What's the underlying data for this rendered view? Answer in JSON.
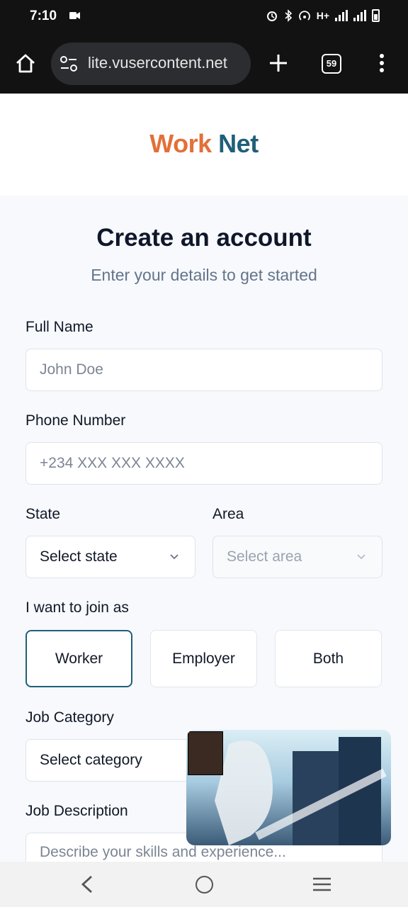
{
  "status_bar": {
    "time": "7:10",
    "network": "H+"
  },
  "browser": {
    "url": "lite.vusercontent.net",
    "tab_count": "59"
  },
  "brand": {
    "part1": "Work",
    "part2": "Net",
    "colors": {
      "work": "#e2703a",
      "net": "#1f5f7a"
    }
  },
  "form": {
    "title": "Create an account",
    "subtitle": "Enter your details to get started",
    "full_name": {
      "label": "Full Name",
      "placeholder": "John Doe"
    },
    "phone": {
      "label": "Phone Number",
      "placeholder": "+234 XXX XXX XXXX"
    },
    "state": {
      "label": "State",
      "value": "Select state"
    },
    "area": {
      "label": "Area",
      "value": "Select area"
    },
    "join_as": {
      "label": "I want to join as",
      "options": [
        "Worker",
        "Employer",
        "Both"
      ],
      "selected": "Worker"
    },
    "job_category": {
      "label": "Job Category",
      "value": "Select category"
    },
    "job_description": {
      "label": "Job Description",
      "placeholder": "Describe your skills and experience..."
    }
  }
}
